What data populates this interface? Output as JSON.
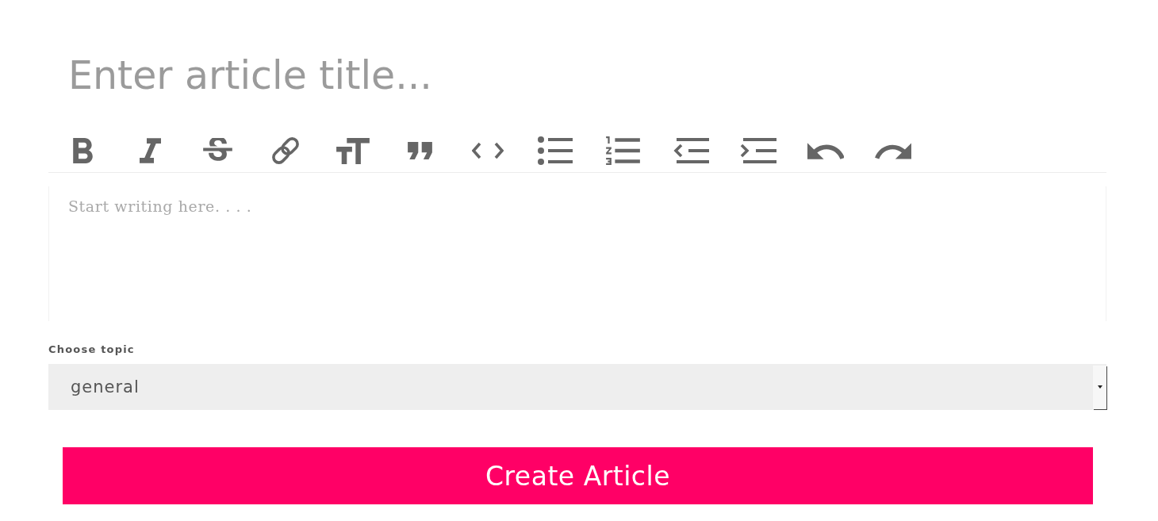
{
  "title_input": {
    "placeholder": "Enter article title..."
  },
  "editor": {
    "placeholder": "Start writing here. . . ."
  },
  "topic": {
    "label": "Choose topic",
    "value": "general"
  },
  "create_button": {
    "label": "Create Article"
  }
}
